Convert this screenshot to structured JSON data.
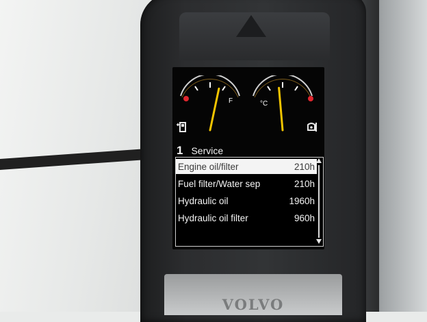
{
  "brand": "VOLVO",
  "gauges": {
    "fuel": {
      "icon": "fuel-pump-icon",
      "level": 0.62
    },
    "coolant": {
      "icon": "oil-can-icon",
      "unit": "°C",
      "level": 0.45
    },
    "needle_color": "#f2c400",
    "warning_color": "#e0262e"
  },
  "service": {
    "icon_label": "1",
    "title": "Service",
    "items": [
      {
        "name": "Engine oil/filter",
        "hours": "210h",
        "selected": true
      },
      {
        "name": "Fuel filter/Water sep",
        "hours": "210h",
        "selected": false
      },
      {
        "name": "Hydraulic oil",
        "hours": "1960h",
        "selected": false
      },
      {
        "name": "Hydraulic oil filter",
        "hours": "960h",
        "selected": false
      }
    ]
  }
}
